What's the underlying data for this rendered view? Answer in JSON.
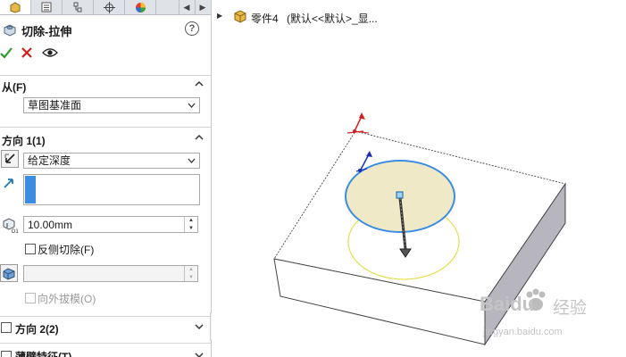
{
  "panel": {
    "title": "切除-拉伸",
    "help_label": "?",
    "from_section": {
      "label": "从(F)",
      "select_value": "草图基准面"
    },
    "direction1": {
      "label": "方向 1(1)",
      "end_condition": "给定深度",
      "depth_value": "10.00mm",
      "flip_side_label": "反侧切除(F)",
      "draft_outward_label": "向外拔模(O)"
    },
    "direction2": {
      "label": "方向 2(2)"
    },
    "thin_feature": {
      "label": "薄壁特征(T)"
    }
  },
  "tree": {
    "part_name": "零件4",
    "config": "(默认<<默认>_显..."
  },
  "watermark": {
    "brand": "Baidu",
    "brand_cn": "经验",
    "url": "jingyan.baidu.com"
  },
  "colors": {
    "confirm": "#2a9d2a",
    "cancel": "#d22020",
    "highlight": "#3a8de0"
  }
}
